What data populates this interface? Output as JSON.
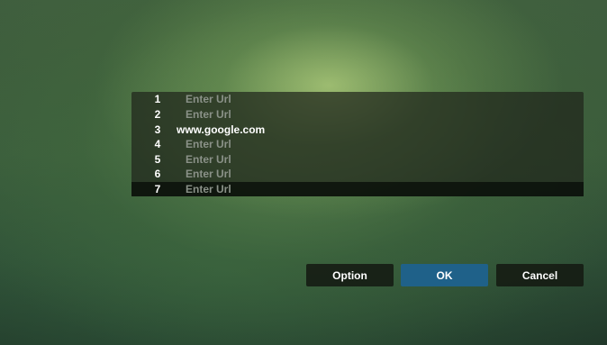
{
  "url_list": {
    "rows": [
      {
        "number": "1",
        "url": "Enter Url"
      },
      {
        "number": "2",
        "url": "Enter Url"
      },
      {
        "number": "3",
        "url": "www.google.com"
      },
      {
        "number": "4",
        "url": "Enter Url"
      },
      {
        "number": "5",
        "url": "Enter Url"
      },
      {
        "number": "6",
        "url": "Enter Url"
      },
      {
        "number": "7",
        "url": "Enter Url"
      }
    ]
  },
  "buttons": {
    "option_label": "Option",
    "ok_label": "OK",
    "cancel_label": "Cancel"
  },
  "colors": {
    "accent": "#1f6189",
    "placeholder_text": "#8a9188",
    "text": "#ffffff"
  }
}
